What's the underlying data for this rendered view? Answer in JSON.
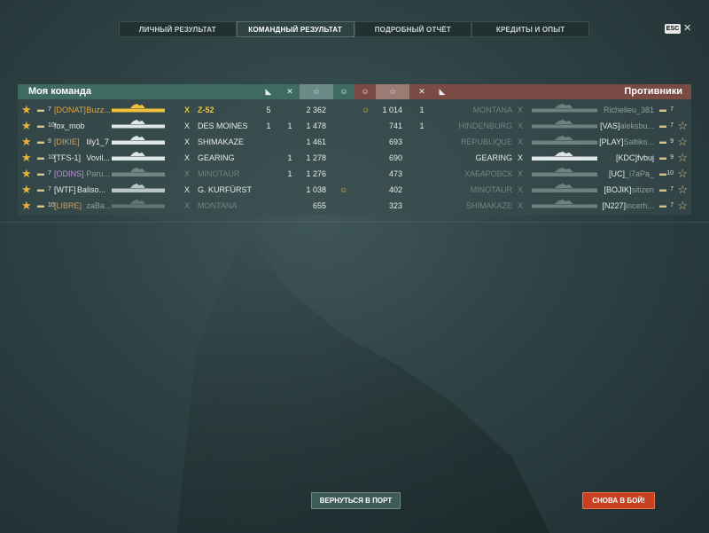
{
  "tabs": [
    {
      "label": "ЛИЧНЫЙ РЕЗУЛЬТАТ",
      "active": false
    },
    {
      "label": "КОМАНДНЫЙ РЕЗУЛЬТАТ",
      "active": true
    },
    {
      "label": "ПОДРОБНЫЙ ОТЧЁТ",
      "active": false
    },
    {
      "label": "КРЕДИТЫ И ОПЫТ",
      "active": false
    }
  ],
  "esc": {
    "label": "ESC",
    "close": "✕"
  },
  "my_team": {
    "title": "Моя команда",
    "rows": [
      {
        "tier": "7",
        "clan": "[DONAT]",
        "name": "Buzz...",
        "clan_class": "clan-gold",
        "ship": "Z-52",
        "ship_style": "gold",
        "planes": "5",
        "kills": "",
        "xp": "2 362",
        "face": "",
        "sil_color": "#f0c23a"
      },
      {
        "tier": "10",
        "clan": "",
        "name": "fox_mob",
        "clan_class": "",
        "ship": "DES MOINES",
        "ship_style": "",
        "planes": "1",
        "kills": "1",
        "xp": "1 478",
        "face": "",
        "sil_color": "#dfe6e6"
      },
      {
        "tier": "9",
        "clan": "[DIKIE]",
        "name": "lily1_7",
        "clan_class": "clan-tan",
        "ship": "SHIMAKAZE",
        "ship_style": "",
        "planes": "",
        "kills": "",
        "xp": "1 461",
        "face": "",
        "sil_color": "#dfe6e6"
      },
      {
        "tier": "10",
        "clan": "[TFS-1]",
        "name": "Vovil...",
        "clan_class": "",
        "ship": "GEARING",
        "ship_style": "",
        "planes": "",
        "kills": "1",
        "xp": "1 278",
        "face": "",
        "sil_color": "#dfe6e6"
      },
      {
        "tier": "7",
        "clan": "[ODINS]",
        "name": "Paru...",
        "clan_class": "clan-purple",
        "ship": "MINOTAUR",
        "ship_style": "dim",
        "planes": "",
        "kills": "1",
        "xp": "1 276",
        "face": "",
        "sil_color": "#6f8684"
      },
      {
        "tier": "7",
        "clan": "[WTF]",
        "name": "Baliso...",
        "clan_class": "",
        "ship": "G. KURFÜRST",
        "ship_style": "",
        "planes": "",
        "kills": "",
        "xp": "1 038",
        "face": "☺",
        "sil_color": "#b9c4c4"
      },
      {
        "tier": "10",
        "clan": "[LIBRE]",
        "name": "zaBa...",
        "clan_class": "clan-tan",
        "ship": "MONTANA",
        "ship_style": "dim",
        "planes": "",
        "kills": "",
        "xp": "655",
        "face": "",
        "sil_color": "#5f7674"
      }
    ]
  },
  "enemy_team": {
    "title": "Противники",
    "rows": [
      {
        "face": "☺",
        "xp": "1 014",
        "kills": "1",
        "ship": "MONTANA",
        "ship_style": "dim",
        "clan": "",
        "name": "Richelieu_381",
        "tier": "7",
        "star": false
      },
      {
        "face": "",
        "xp": "741",
        "kills": "1",
        "ship": "HINDENBURG",
        "ship_style": "dim",
        "clan": "[VAS]",
        "name": "aleksbu...",
        "tier": "7",
        "star": true
      },
      {
        "face": "",
        "xp": "693",
        "kills": "",
        "ship": "REPUBLIQUE",
        "ship_style": "dim",
        "clan": "[PLAY]",
        "name": "Saltiko...",
        "tier": "9",
        "star": true
      },
      {
        "face": "",
        "xp": "690",
        "kills": "",
        "ship": "GEARING",
        "ship_style": "",
        "clan": "[KDC]",
        "name": "fvbuj",
        "tier": "9",
        "star": true
      },
      {
        "face": "",
        "xp": "473",
        "kills": "",
        "ship": "ХАБАРОВСК",
        "ship_style": "dim",
        "clan": "[UC]",
        "name": "_i7aPa_",
        "tier": "10",
        "star": true
      },
      {
        "face": "",
        "xp": "402",
        "kills": "",
        "ship": "MINOTAUR",
        "ship_style": "dim",
        "clan": "[BOJIK]",
        "name": "sitizen",
        "tier": "7",
        "star": true
      },
      {
        "face": "",
        "xp": "323",
        "kills": "",
        "ship": "SHIMAKAZE",
        "ship_style": "dim",
        "clan": "[N227]",
        "name": "incerh...",
        "tier": "7",
        "star": true
      }
    ]
  },
  "buttons": {
    "port": "ВЕРНУТЬСЯ В ПОРТ",
    "battle": "СНОВА В БОЙ!"
  }
}
